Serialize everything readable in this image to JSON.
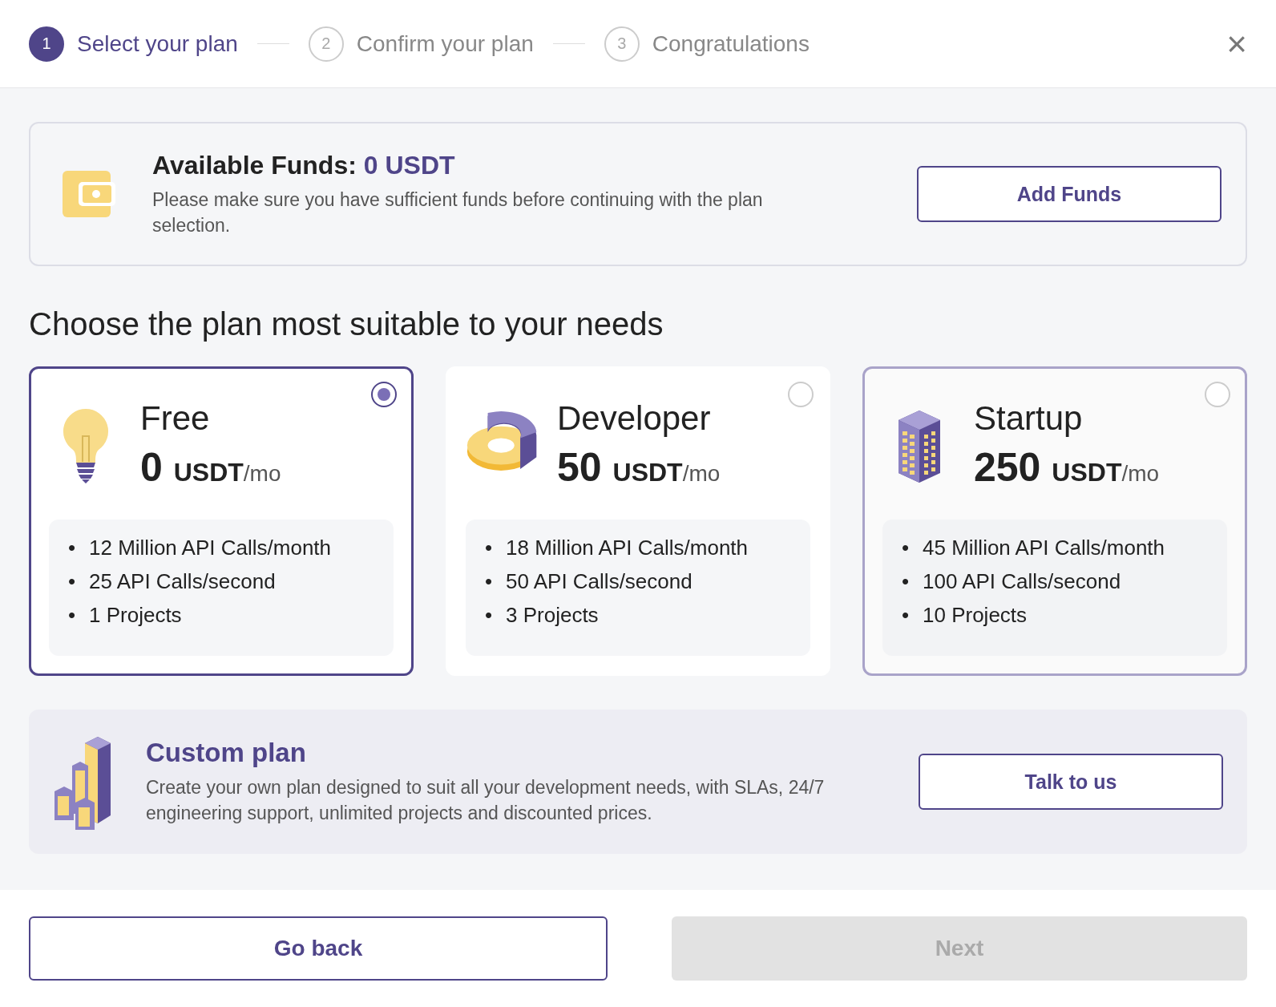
{
  "steps": [
    {
      "number": "1",
      "label": "Select your plan",
      "selected": true
    },
    {
      "number": "2",
      "label": "Confirm your plan",
      "selected": false
    },
    {
      "number": "3",
      "label": "Congratulations",
      "selected": false
    }
  ],
  "close": "×",
  "funds": {
    "label": "Available Funds:",
    "amount": "0 USDT",
    "note": "Please make sure you have sufficient funds before continuing with the plan selection.",
    "button": "Add Funds"
  },
  "heading": "Choose the plan most suitable to your needs",
  "plans": [
    {
      "kind": "bulb",
      "name": "Free",
      "price": "0",
      "currency": "USDT",
      "period": "/mo",
      "selected": true,
      "hovered": false,
      "features": [
        {
          "bullet": "•",
          "text": "12 Million API Calls/month"
        },
        {
          "bullet": "•",
          "text": "25 API Calls/second"
        },
        {
          "bullet": "•",
          "text": "1 Projects"
        }
      ]
    },
    {
      "kind": "donut",
      "name": "Developer",
      "price": "50",
      "currency": "USDT",
      "period": "/mo",
      "selected": false,
      "hovered": false,
      "features": [
        {
          "bullet": "•",
          "text": "18 Million API Calls/month"
        },
        {
          "bullet": "•",
          "text": "50 API Calls/second"
        },
        {
          "bullet": "•",
          "text": "3 Projects"
        }
      ]
    },
    {
      "kind": "building",
      "name": "Startup",
      "price": "250",
      "currency": "USDT",
      "period": "/mo",
      "selected": false,
      "hovered": true,
      "features": [
        {
          "bullet": "•",
          "text": "45 Million API Calls/month"
        },
        {
          "bullet": "•",
          "text": "100 API Calls/second"
        },
        {
          "bullet": "•",
          "text": "10 Projects"
        }
      ]
    }
  ],
  "custom": {
    "title": "Custom plan",
    "text": "Create your own plan designed to suit all your development needs, with SLAs, 24/7 engineering support, unlimited projects and discounted prices.",
    "button": "Talk to us"
  },
  "footer": {
    "back": "Go back",
    "next": "Next",
    "next_disabled": true
  }
}
